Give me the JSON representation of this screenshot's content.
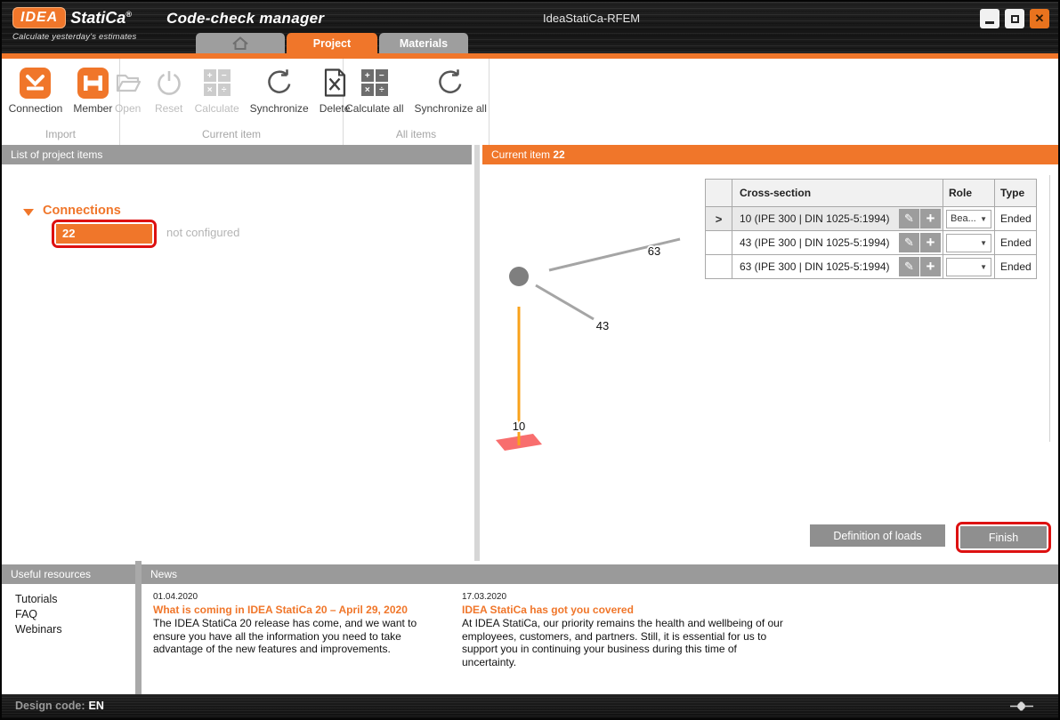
{
  "titlebar": {
    "logo_text": "IDEA",
    "brand": "StatiCa",
    "brand_reg": "®",
    "tagline": "Calculate yesterday's estimates",
    "app_title": "Code-check manager",
    "window_title": "IdeaStatiCa-RFEM"
  },
  "tabs": {
    "project": "Project",
    "materials": "Materials"
  },
  "toolbar": {
    "connection": "Connection",
    "member": "Member",
    "open": "Open",
    "reset": "Reset",
    "calculate": "Calculate",
    "synchronize": "Synchronize",
    "delete": "Delete",
    "calculate_all": "Calculate all",
    "synchronize_all": "Synchronize all",
    "group_import": "Import",
    "group_current": "Current item",
    "group_all": "All items"
  },
  "left_panel": {
    "header": "List of project items",
    "tree_root": "Connections",
    "item": "22",
    "item_status": "not configured"
  },
  "right_panel": {
    "header_label": "Current item",
    "header_value": "22",
    "diagram_labels": {
      "member_63": "63",
      "member_43": "43",
      "member_10": "10"
    },
    "table": {
      "headers": {
        "cross_section": "Cross-section",
        "role": "Role",
        "type": "Type"
      },
      "rows": [
        {
          "selector": ">",
          "cross_section": "10 (IPE 300 | DIN 1025-5:1994)",
          "role": "Bea...",
          "type": "Ended"
        },
        {
          "selector": "",
          "cross_section": "43 (IPE 300 | DIN 1025-5:1994)",
          "role": "",
          "type": "Ended"
        },
        {
          "selector": "",
          "cross_section": "63 (IPE 300 | DIN 1025-5:1994)",
          "role": "",
          "type": "Ended"
        }
      ]
    },
    "buttons": {
      "definition_of_loads": "Definition of loads",
      "finish": "Finish"
    }
  },
  "resources": {
    "header": "Useful resources",
    "items": [
      "Tutorials",
      "FAQ",
      "Webinars"
    ]
  },
  "news": {
    "header": "News",
    "articles": [
      {
        "date": "01.04.2020",
        "title": "What is coming in IDEA StatiCa 20 – April 29, 2020",
        "body": "The IDEA StatiCa 20 release has come, and we want to ensure you have all the information you need to take advantage of the new features and improvements."
      },
      {
        "date": "17.03.2020",
        "title": "IDEA StatiCa has got you covered",
        "body": "At IDEA StatiCa, our priority remains the health and wellbeing of our employees, customers, and partners. Still, it is essential for us to support you in continuing your business during this time of uncertainty."
      }
    ]
  },
  "statusbar": {
    "design_code_label": "Design code:",
    "design_code_value": "EN"
  },
  "colors": {
    "accent": "#f0762a",
    "annotation": "#dd1111",
    "support": "#f86e6e",
    "load_line": "#f9a21b",
    "member_line": "#a5a5a5"
  }
}
